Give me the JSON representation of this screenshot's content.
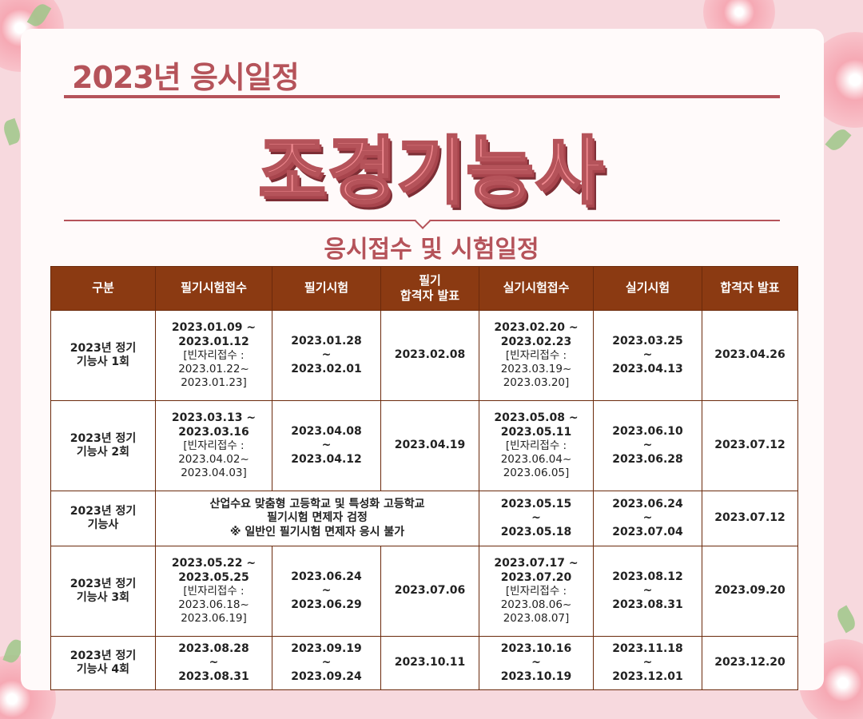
{
  "header": {
    "year_title": "2023년 응시일정",
    "main_title": "조경기능사",
    "section_title": "응시접수 및 시험일정"
  },
  "colors": {
    "brand": "#b5535a",
    "title_fill": "#f08b91",
    "table_header": "#8b3a12",
    "background": "#f7d9de"
  },
  "table": {
    "headers": [
      "구분",
      "필기시험접수",
      "필기시험",
      "필기\n합격자 발표",
      "실기시험접수",
      "실기시험",
      "합격자 발표"
    ],
    "rows": [
      {
        "label": "2023년 정기\n기능사 1회",
        "written_reg": "2023.01.09 ~\n2023.01.12",
        "written_reg_note": "[빈자리접수 :\n2023.01.22~\n2023.01.23]",
        "written_exam": "2023.01.28\n~\n2023.02.01",
        "written_result": "2023.02.08",
        "practical_reg": "2023.02.20 ~\n2023.02.23",
        "practical_reg_note": "[빈자리접수 :\n2023.03.19~\n2023.03.20]",
        "practical_exam": "2023.03.25\n~\n2023.04.13",
        "final_result": "2023.04.26"
      },
      {
        "label": "2023년 정기\n기능사 2회",
        "written_reg": "2023.03.13 ~\n2023.03.16",
        "written_reg_note": "[빈자리접수 :\n2023.04.02~\n2023.04.03]",
        "written_exam": "2023.04.08\n~\n2023.04.12",
        "written_result": "2023.04.19",
        "practical_reg": "2023.05.08 ~\n2023.05.11",
        "practical_reg_note": "[빈자리접수 :\n2023.06.04~\n2023.06.05]",
        "practical_exam": "2023.06.10\n~\n2023.06.28",
        "final_result": "2023.07.12"
      },
      {
        "label": "2023년 정기\n기능사",
        "merged_note": [
          "산업수요 맞춤형 고등학교 및 특성화 고등학교",
          "필기시험 면제자 검정",
          "※ 일반인 필기시험 면제자 응시 불가"
        ],
        "practical_reg": "2023.05.15\n~\n2023.05.18",
        "practical_exam": "2023.06.24\n~\n2023.07.04",
        "final_result": "2023.07.12"
      },
      {
        "label": "2023년 정기\n기능사 3회",
        "written_reg": "2023.05.22 ~\n2023.05.25",
        "written_reg_note": "[빈자리접수 :\n2023.06.18~\n2023.06.19]",
        "written_exam": "2023.06.24\n~\n2023.06.29",
        "written_result": "2023.07.06",
        "practical_reg": "2023.07.17 ~\n2023.07.20",
        "practical_reg_note": "[빈자리접수 :\n2023.08.06~\n2023.08.07]",
        "practical_exam": "2023.08.12\n~\n2023.08.31",
        "final_result": "2023.09.20"
      },
      {
        "label": "2023년 정기\n기능사 4회",
        "written_reg": "2023.08.28\n~\n2023.08.31",
        "written_exam": "2023.09.19\n~\n2023.09.24",
        "written_result": "2023.10.11",
        "practical_reg": "2023.10.16\n~\n2023.10.19",
        "practical_exam": "2023.11.18\n~\n2023.12.01",
        "final_result": "2023.12.20"
      }
    ]
  }
}
